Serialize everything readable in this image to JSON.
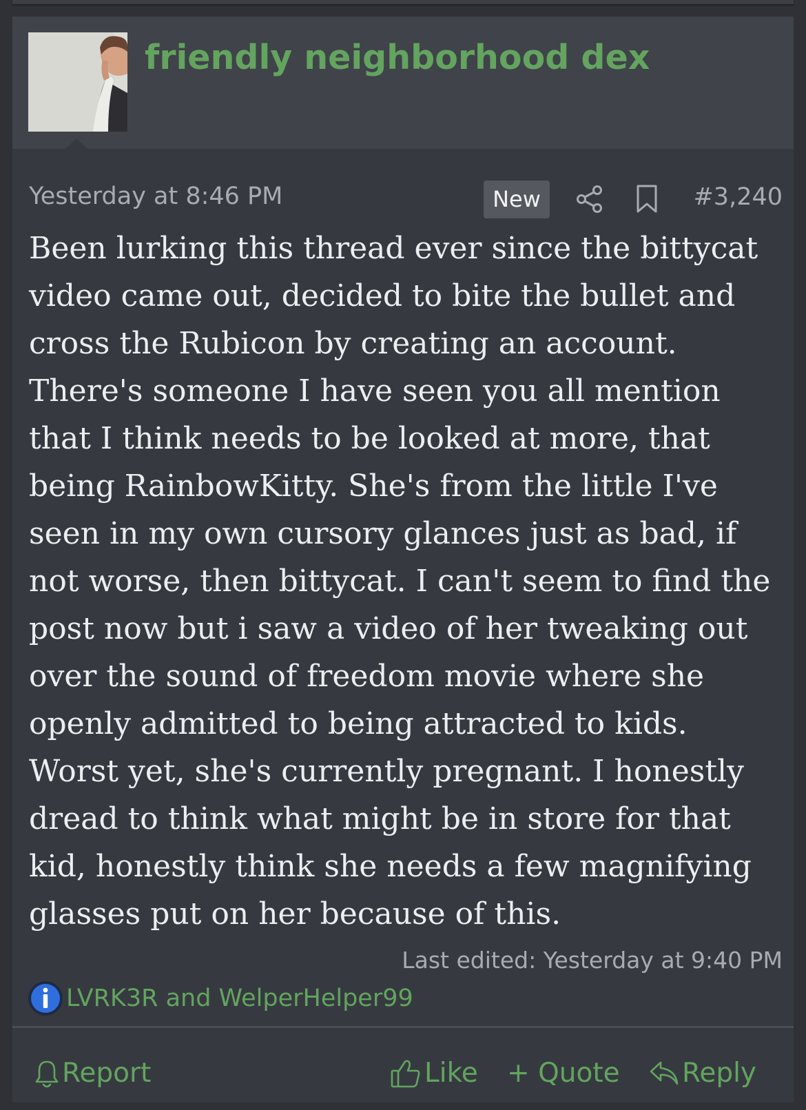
{
  "post": {
    "author": "friendly neighborhood dex",
    "timestamp": "Yesterday at 8:46 PM",
    "new_badge": "New",
    "post_number": "#3,240",
    "body": "Been lurking this thread ever since the bittycat video came out, decided to bite the bullet and cross the Rubicon by creating an account. There's someone I have seen you all mention that I think needs to be looked at more, that being RainbowKitty. She's from the little I've seen in my own cursory glances just as bad, if not worse, then bittycat. I can't seem to find the post now but i saw a video of her tweaking out over the sound of freedom movie where she openly admitted to being attracted to kids. Worst yet, she's currently pregnant. I honestly dread to think what might be in store for that kid, honestly think she needs a few magnifying glasses put on her because of this.",
    "last_edited": "Last edited: Yesterday at 9:40 PM",
    "reactions": {
      "icon": "info-icon",
      "users": "LVRK3R and WelperHelper99"
    }
  },
  "actions": {
    "report": {
      "label": "Report",
      "icon": "bell-icon"
    },
    "like": {
      "label": "Like",
      "icon": "thumbs-up-icon"
    },
    "quote": {
      "label": "+ Quote",
      "icon": "plus-icon"
    },
    "reply": {
      "label": "Reply",
      "icon": "reply-arrow-icon"
    }
  },
  "meta_icons": [
    "share-icon",
    "bookmark-icon"
  ],
  "colors": {
    "accent": "#63a45f",
    "background": "#363a40",
    "header_background": "#40434a",
    "text": "#eceef1",
    "muted_text": "#a8acb2",
    "info_badge": "#2f6fdd"
  }
}
